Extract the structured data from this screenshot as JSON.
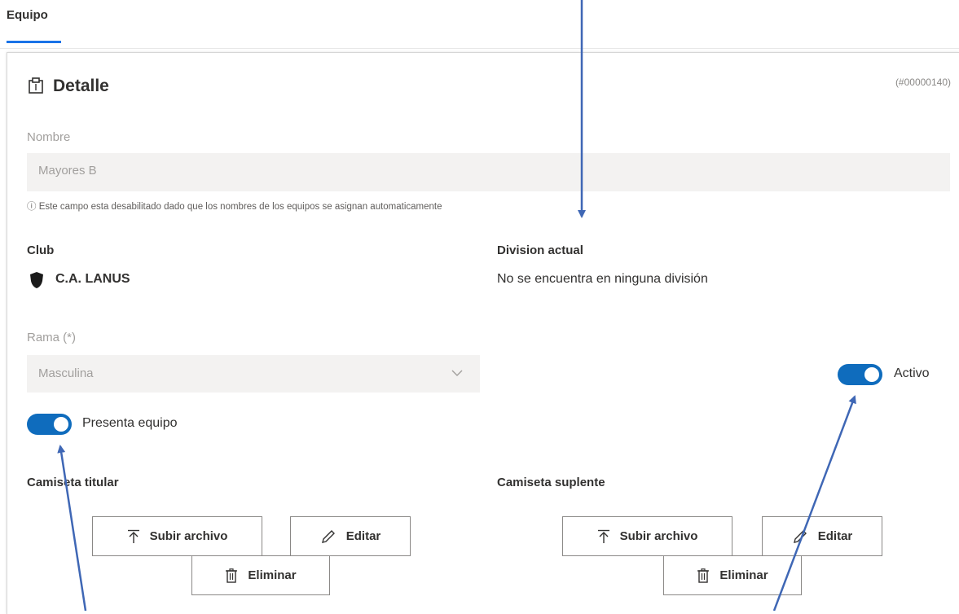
{
  "tab": {
    "label": "Equipo"
  },
  "detail": {
    "title": "Detalle",
    "record_id": "(#00000140)"
  },
  "nombre": {
    "label": "Nombre",
    "value": "Mayores B",
    "hint": "ⓘ Este campo esta desabilitado dado que los nombres de los equipos se asignan automaticamente"
  },
  "club": {
    "label": "Club",
    "name": "C.A. LANUS"
  },
  "division": {
    "label": "Division actual",
    "value": "No se encuentra en ninguna división"
  },
  "rama": {
    "label": "Rama (*)",
    "selected": "Masculina"
  },
  "toggles": {
    "activo": {
      "label": "Activo",
      "on": true
    },
    "presenta_equipo": {
      "label": "Presenta equipo",
      "on": true
    }
  },
  "camiseta_titular": {
    "label": "Camiseta titular",
    "upload_label": "Subir archivo",
    "edit_label": "Editar",
    "delete_label": "Eliminar"
  },
  "camiseta_suplente": {
    "label": "Camiseta suplente",
    "upload_label": "Subir archivo",
    "edit_label": "Editar",
    "delete_label": "Eliminar"
  },
  "colors": {
    "accent": "#0f6cbd",
    "annotation_arrow": "#3f67b5"
  },
  "icons": {
    "detail": "clipboard-icon",
    "club": "shield-icon",
    "upload": "upload-icon",
    "edit": "pencil-icon",
    "delete": "trash-icon",
    "select": "chevron-down-icon"
  }
}
